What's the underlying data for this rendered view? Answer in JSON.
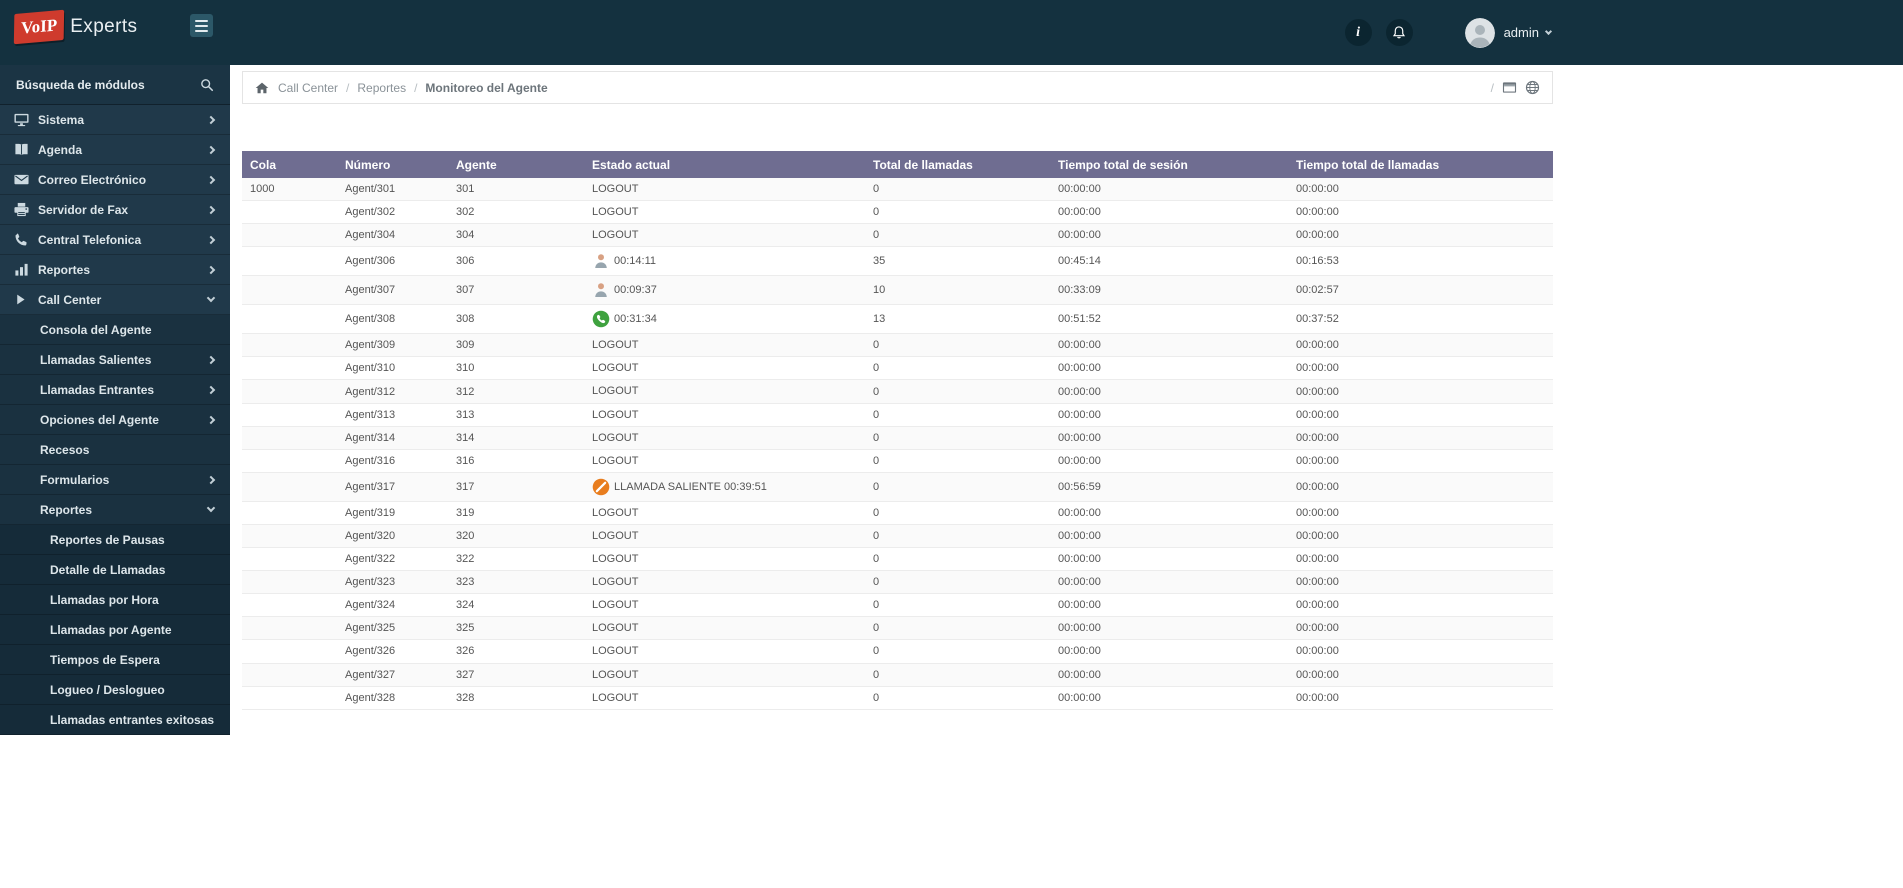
{
  "colors": {
    "header_bg": "#14313f",
    "sidebar_bg": "#1e3848",
    "logo_red": "#cf3b2d",
    "table_header_bg": "#6f6d91",
    "status_green": "#3fa23f",
    "status_orange": "#e87d1e"
  },
  "header": {
    "logo_primary": "VoIP",
    "logo_secondary": "Experts",
    "user_name": "admin"
  },
  "sidebar": {
    "search_label": "Búsqueda de módulos",
    "items": [
      {
        "label": "Sistema",
        "icon": "monitor-icon",
        "level": 0,
        "arrow": "right"
      },
      {
        "label": "Agenda",
        "icon": "book-icon",
        "level": 0,
        "arrow": "right"
      },
      {
        "label": "Correo Electrónico",
        "icon": "mail-icon",
        "level": 0,
        "arrow": "right"
      },
      {
        "label": "Servidor de Fax",
        "icon": "fax-icon",
        "level": 0,
        "arrow": "right"
      },
      {
        "label": "Central Telefonica",
        "icon": "phone-icon",
        "level": 0,
        "arrow": "right"
      },
      {
        "label": "Reportes",
        "icon": "chart-icon",
        "level": 0,
        "arrow": "right"
      },
      {
        "label": "Call Center",
        "icon": "play-icon",
        "level": 0,
        "arrow": "down",
        "expanded": true
      },
      {
        "label": "Consola del Agente",
        "level": 1
      },
      {
        "label": "Llamadas Salientes",
        "level": 1,
        "arrow": "right"
      },
      {
        "label": "Llamadas Entrantes",
        "level": 1,
        "arrow": "right"
      },
      {
        "label": "Opciones del Agente",
        "level": 1,
        "arrow": "right"
      },
      {
        "label": "Recesos",
        "level": 1
      },
      {
        "label": "Formularios",
        "level": 1,
        "arrow": "right"
      },
      {
        "label": "Reportes",
        "level": 1,
        "arrow": "down",
        "expanded": true
      },
      {
        "label": "Reportes de Pausas",
        "level": 2
      },
      {
        "label": "Detalle de Llamadas",
        "level": 2
      },
      {
        "label": "Llamadas por Hora",
        "level": 2
      },
      {
        "label": "Llamadas por Agente",
        "level": 2
      },
      {
        "label": "Tiempos de Espera",
        "level": 2
      },
      {
        "label": "Logueo / Deslogueo",
        "level": 2
      },
      {
        "label": "Llamadas entrantes exitosas",
        "level": 2
      }
    ]
  },
  "breadcrumb": {
    "items": [
      "Call Center",
      "Reportes",
      "Monitoreo del Agente"
    ],
    "separator": "/"
  },
  "table": {
    "columns": [
      "Cola",
      "Número",
      "Agente",
      "Estado actual",
      "Total de llamadas",
      "Tiempo total de sesión",
      "Tiempo total de llamadas"
    ],
    "rows": [
      {
        "cola": "1000",
        "numero": "Agent/301",
        "agente": "301",
        "estado": {
          "type": "logout",
          "text": "LOGOUT"
        },
        "total": "0",
        "sesion": "00:00:00",
        "llamadas": "00:00:00"
      },
      {
        "cola": "",
        "numero": "Agent/302",
        "agente": "302",
        "estado": {
          "type": "logout",
          "text": "LOGOUT"
        },
        "total": "0",
        "sesion": "00:00:00",
        "llamadas": "00:00:00"
      },
      {
        "cola": "",
        "numero": "Agent/304",
        "agente": "304",
        "estado": {
          "type": "logout",
          "text": "LOGOUT"
        },
        "total": "0",
        "sesion": "00:00:00",
        "llamadas": "00:00:00"
      },
      {
        "cola": "",
        "numero": "Agent/306",
        "agente": "306",
        "estado": {
          "type": "paused",
          "text": "00:14:11"
        },
        "total": "35",
        "sesion": "00:45:14",
        "llamadas": "00:16:53"
      },
      {
        "cola": "",
        "numero": "Agent/307",
        "agente": "307",
        "estado": {
          "type": "paused",
          "text": "00:09:37"
        },
        "total": "10",
        "sesion": "00:33:09",
        "llamadas": "00:02:57"
      },
      {
        "cola": "",
        "numero": "Agent/308",
        "agente": "308",
        "estado": {
          "type": "oncall",
          "text": "00:31:34"
        },
        "total": "13",
        "sesion": "00:51:52",
        "llamadas": "00:37:52"
      },
      {
        "cola": "",
        "numero": "Agent/309",
        "agente": "309",
        "estado": {
          "type": "logout",
          "text": "LOGOUT"
        },
        "total": "0",
        "sesion": "00:00:00",
        "llamadas": "00:00:00"
      },
      {
        "cola": "",
        "numero": "Agent/310",
        "agente": "310",
        "estado": {
          "type": "logout",
          "text": "LOGOUT"
        },
        "total": "0",
        "sesion": "00:00:00",
        "llamadas": "00:00:00"
      },
      {
        "cola": "",
        "numero": "Agent/312",
        "agente": "312",
        "estado": {
          "type": "logout",
          "text": "LOGOUT"
        },
        "total": "0",
        "sesion": "00:00:00",
        "llamadas": "00:00:00"
      },
      {
        "cola": "",
        "numero": "Agent/313",
        "agente": "313",
        "estado": {
          "type": "logout",
          "text": "LOGOUT"
        },
        "total": "0",
        "sesion": "00:00:00",
        "llamadas": "00:00:00"
      },
      {
        "cola": "",
        "numero": "Agent/314",
        "agente": "314",
        "estado": {
          "type": "logout",
          "text": "LOGOUT"
        },
        "total": "0",
        "sesion": "00:00:00",
        "llamadas": "00:00:00"
      },
      {
        "cola": "",
        "numero": "Agent/316",
        "agente": "316",
        "estado": {
          "type": "logout",
          "text": "LOGOUT"
        },
        "total": "0",
        "sesion": "00:00:00",
        "llamadas": "00:00:00"
      },
      {
        "cola": "",
        "numero": "Agent/317",
        "agente": "317",
        "estado": {
          "type": "outgoing",
          "text": "LLAMADA SALIENTE 00:39:51"
        },
        "total": "0",
        "sesion": "00:56:59",
        "llamadas": "00:00:00"
      },
      {
        "cola": "",
        "numero": "Agent/319",
        "agente": "319",
        "estado": {
          "type": "logout",
          "text": "LOGOUT"
        },
        "total": "0",
        "sesion": "00:00:00",
        "llamadas": "00:00:00"
      },
      {
        "cola": "",
        "numero": "Agent/320",
        "agente": "320",
        "estado": {
          "type": "logout",
          "text": "LOGOUT"
        },
        "total": "0",
        "sesion": "00:00:00",
        "llamadas": "00:00:00"
      },
      {
        "cola": "",
        "numero": "Agent/322",
        "agente": "322",
        "estado": {
          "type": "logout",
          "text": "LOGOUT"
        },
        "total": "0",
        "sesion": "00:00:00",
        "llamadas": "00:00:00"
      },
      {
        "cola": "",
        "numero": "Agent/323",
        "agente": "323",
        "estado": {
          "type": "logout",
          "text": "LOGOUT"
        },
        "total": "0",
        "sesion": "00:00:00",
        "llamadas": "00:00:00"
      },
      {
        "cola": "",
        "numero": "Agent/324",
        "agente": "324",
        "estado": {
          "type": "logout",
          "text": "LOGOUT"
        },
        "total": "0",
        "sesion": "00:00:00",
        "llamadas": "00:00:00"
      },
      {
        "cola": "",
        "numero": "Agent/325",
        "agente": "325",
        "estado": {
          "type": "logout",
          "text": "LOGOUT"
        },
        "total": "0",
        "sesion": "00:00:00",
        "llamadas": "00:00:00"
      },
      {
        "cola": "",
        "numero": "Agent/326",
        "agente": "326",
        "estado": {
          "type": "logout",
          "text": "LOGOUT"
        },
        "total": "0",
        "sesion": "00:00:00",
        "llamadas": "00:00:00"
      },
      {
        "cola": "",
        "numero": "Agent/327",
        "agente": "327",
        "estado": {
          "type": "logout",
          "text": "LOGOUT"
        },
        "total": "0",
        "sesion": "00:00:00",
        "llamadas": "00:00:00"
      },
      {
        "cola": "",
        "numero": "Agent/328",
        "agente": "328",
        "estado": {
          "type": "logout",
          "text": "LOGOUT"
        },
        "total": "0",
        "sesion": "00:00:00",
        "llamadas": "00:00:00"
      }
    ]
  }
}
